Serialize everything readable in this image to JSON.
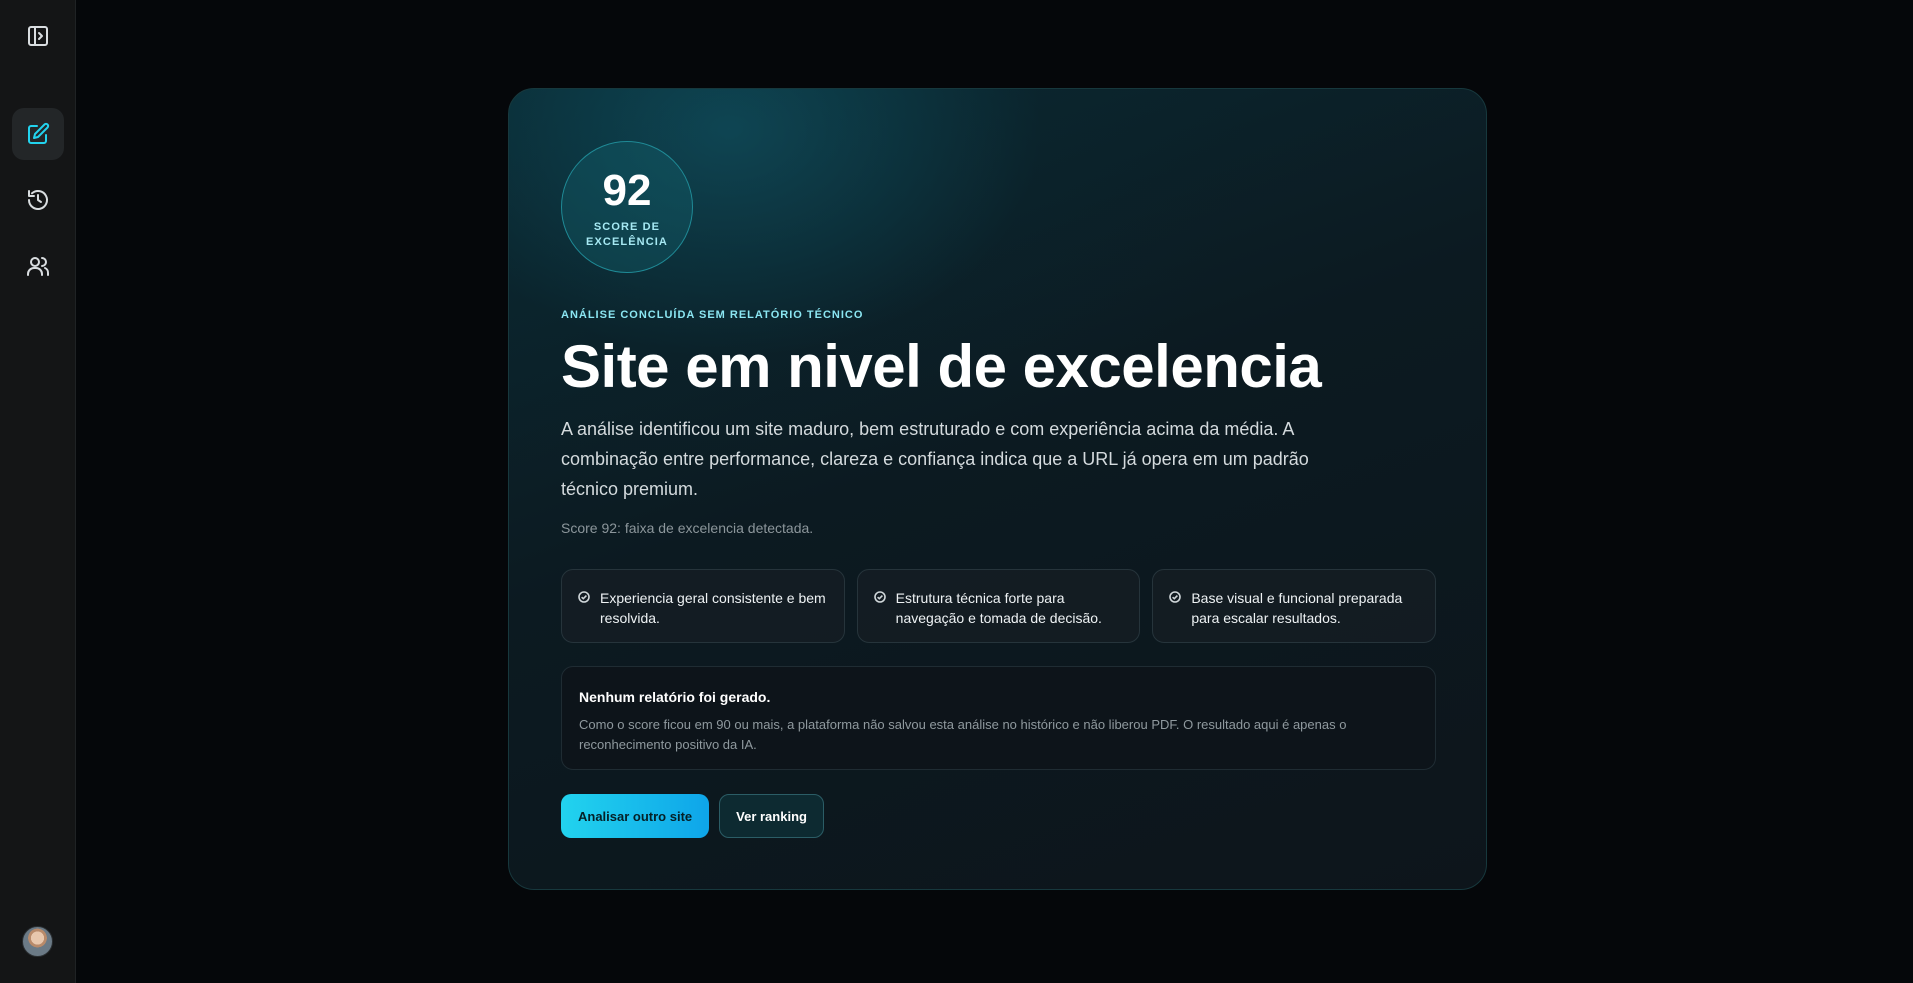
{
  "score": {
    "value": "92",
    "label": "SCORE DE EXCELÊNCIA"
  },
  "eyebrow": "ANÁLISE CONCLUÍDA SEM RELATÓRIO TÉCNICO",
  "headline": "Site em nivel de excelencia",
  "description": "A análise identificou um site maduro, bem estruturado e com experiência acima da média. A combinação entre performance, clareza e confiança indica que a URL já opera em um padrão técnico premium.",
  "score_note": "Score 92: faixa de excelencia detectada.",
  "features": [
    {
      "text": "Experiencia geral consistente e bem resolvida."
    },
    {
      "text": "Estrutura técnica forte para navegação e tomada de decisão."
    },
    {
      "text": "Base visual e funcional preparada para escalar resultados."
    }
  ],
  "notice": {
    "title": "Nenhum relatório foi gerado.",
    "text": "Como o score ficou em 90 ou mais, a plataforma não salvou esta análise no histórico e não liberou PDF. O resultado aqui é apenas o reconhecimento positivo da IA."
  },
  "actions": {
    "primary_label": "Analisar outro site",
    "secondary_label": "Ver ranking"
  },
  "sidebar": {
    "icons": [
      "panel-toggle-icon",
      "edit-icon",
      "history-icon",
      "users-icon"
    ],
    "accent_color": "#22d3ee"
  }
}
